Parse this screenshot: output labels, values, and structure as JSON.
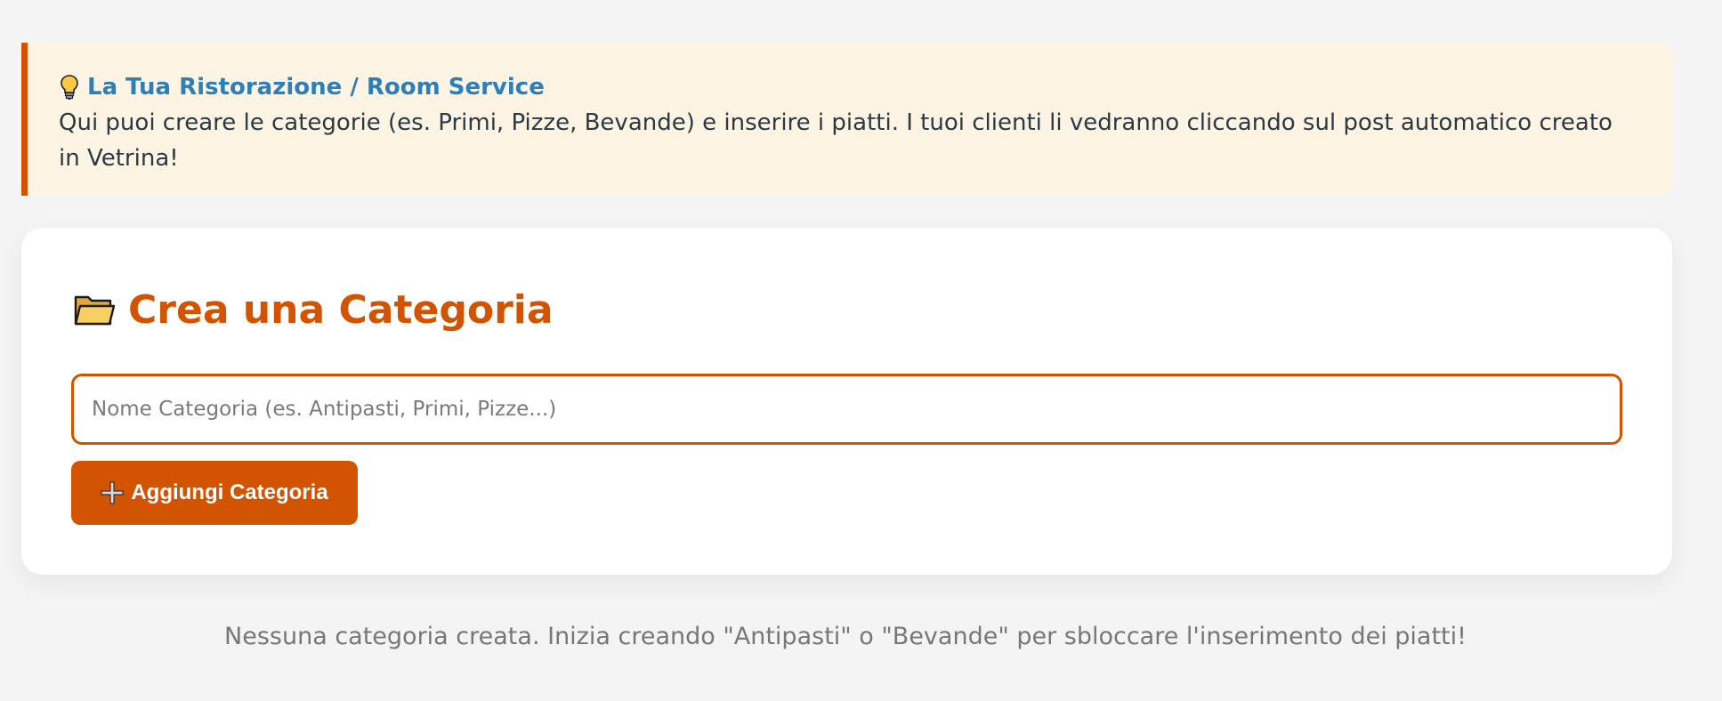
{
  "info": {
    "icon": "lightbulb-icon",
    "title": "La Tua Ristorazione / Room Service",
    "text": "Qui puoi creare le categorie (es. Primi, Pizze, Bevande) e inserire i piatti. I tuoi clienti li vedranno cliccando sul post automatico creato in Vetrina!"
  },
  "card": {
    "icon": "folder-icon",
    "title": "Crea una Categoria",
    "input": {
      "value": "",
      "placeholder": "Nome Categoria (es. Antipasti, Primi, Pizze...)"
    },
    "button": {
      "icon": "plus-icon",
      "label": "Aggiungi Categoria"
    }
  },
  "empty_message": "Nessuna categoria creata. Inizia creando \"Antipasti\" o \"Bevande\" per sbloccare l'inserimento dei piatti!",
  "colors": {
    "accent": "#d35400",
    "info_background": "#fdf4e3",
    "info_title": "#2d7fb8",
    "page_background": "#f3f4f3"
  }
}
